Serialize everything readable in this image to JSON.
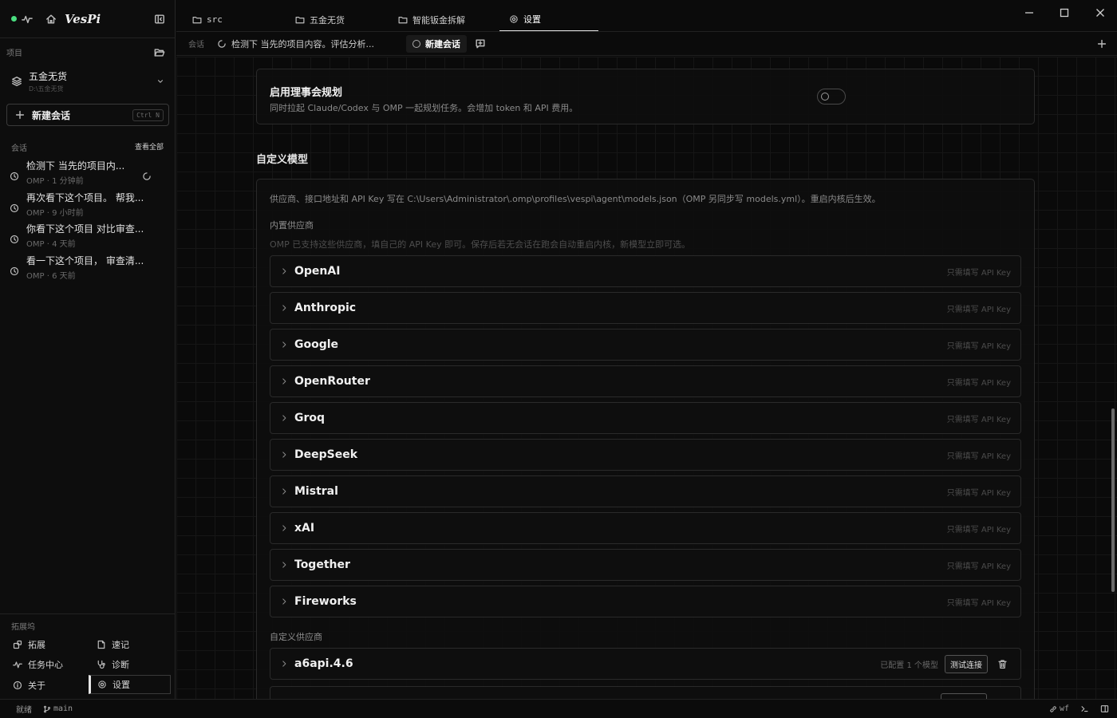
{
  "app": {
    "logo": "VesPi"
  },
  "sidebar": {
    "projects_label": "项目",
    "project": {
      "name": "五金无货",
      "path": "D:\\五金无货"
    },
    "new_chat": {
      "label": "新建会话",
      "shortcut": "Ctrl N"
    },
    "chats_label": "会话",
    "view_all": "查看全部",
    "chats": [
      {
        "title": "检测下 当先的项目内...",
        "meta": "OMP · 1 分钟前",
        "loading": true
      },
      {
        "title": "再次看下这个项目。 帮我...",
        "meta": "OMP · 9 小时前"
      },
      {
        "title": "你看下这个项目 对比审查...",
        "meta": "OMP · 4 天前"
      },
      {
        "title": "看一下这个项目， 审查清...",
        "meta": "OMP · 6 天前"
      }
    ],
    "extensions_label": "拓展坞",
    "extensions": [
      {
        "label": "拓展",
        "icon": "puzzle-icon"
      },
      {
        "label": "速记",
        "icon": "note-icon"
      },
      {
        "label": "任务中心",
        "icon": "activity-icon"
      },
      {
        "label": "诊断",
        "icon": "stethoscope-icon"
      },
      {
        "label": "关于",
        "icon": "info-icon"
      },
      {
        "label": "设置",
        "icon": "gear-icon",
        "active": true
      }
    ]
  },
  "tabs": [
    {
      "label": "src",
      "icon": "folder-icon"
    },
    {
      "label": "五金无货",
      "icon": "folder-icon"
    },
    {
      "label": "智能钣金拆解",
      "icon": "folder-icon"
    },
    {
      "label": "设置",
      "icon": "gear-icon",
      "active": true
    }
  ],
  "session_bar": {
    "label": "会话",
    "tabs": [
      {
        "label": "检测下 当先的项目内容。评估分析...",
        "loading": true
      },
      {
        "label": "新建会话",
        "active": true
      }
    ]
  },
  "settings": {
    "council": {
      "title": "启用理事会规划",
      "description": "同时拉起 Claude/Codex 与 OMP 一起规划任务。会增加 token 和 API 费用。",
      "enabled": false
    },
    "custom_models": {
      "heading": "自定义模型",
      "note": "供应商、接口地址和 API Key 写在 C:\\Users\\Administrator\\.omp\\profiles\\vespi\\agent\\models.json（OMP 另同步写 models.yml）。重启内核后生效。",
      "builtin_label": "内置供应商",
      "builtin_desc": "OMP 已支持这些供应商，填自己的 API Key 即可。保存后若无会话在跑会自动重启内核，新模型立即可选。",
      "providers": [
        {
          "name": "OpenAI",
          "hint": "只需填写 API Key"
        },
        {
          "name": "Anthropic",
          "hint": "只需填写 API Key"
        },
        {
          "name": "Google",
          "hint": "只需填写 API Key"
        },
        {
          "name": "OpenRouter",
          "hint": "只需填写 API Key"
        },
        {
          "name": "Groq",
          "hint": "只需填写 API Key"
        },
        {
          "name": "DeepSeek",
          "hint": "只需填写 API Key"
        },
        {
          "name": "Mistral",
          "hint": "只需填写 API Key"
        },
        {
          "name": "xAI",
          "hint": "只需填写 API Key"
        },
        {
          "name": "Together",
          "hint": "只需填写 API Key"
        },
        {
          "name": "Fireworks",
          "hint": "只需填写 API Key"
        }
      ],
      "custom_label": "自定义供应商",
      "custom_providers": [
        {
          "name": "a6api.4.6",
          "status": "已配置 1 个模型",
          "test_label": "测试连接"
        }
      ]
    }
  },
  "status_bar": {
    "state": "就绪",
    "branch": "main",
    "user": "wf"
  },
  "colors": {
    "accent": "#e6e6e6",
    "online": "#4ade80",
    "background": "#0b0b0b"
  }
}
